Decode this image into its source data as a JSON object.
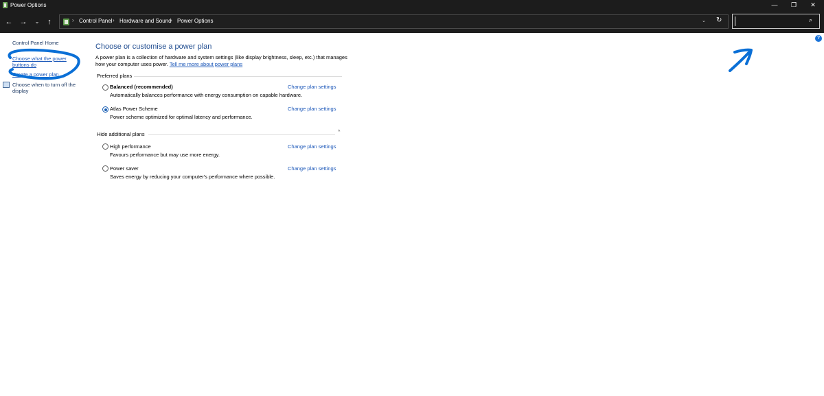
{
  "window": {
    "title": "Power Options",
    "icon": "power-options-icon",
    "controls": {
      "minimize": "—",
      "maximize": "❐",
      "close": "✕"
    }
  },
  "nav": {
    "back": "←",
    "forward": "→",
    "recent": "⌄",
    "up": "↑"
  },
  "address": {
    "separator": "›",
    "crumbs": [
      "Control Panel",
      "Hardware and Sound",
      "Power Options"
    ],
    "dropdown": "⌄",
    "refresh": "↻"
  },
  "search": {
    "value": "",
    "icon": "⌕"
  },
  "help": {
    "label": "?"
  },
  "sidebar": {
    "home": "Control Panel Home",
    "items": [
      {
        "label": "Choose what the power buttons do"
      },
      {
        "label": "Create a power plan"
      },
      {
        "label": "Choose when to turn off the display",
        "icon": "monitor-icon"
      }
    ]
  },
  "main": {
    "title": "Choose or customise a power plan",
    "intro": "A power plan is a collection of hardware and system settings (like display brightness, sleep, etc.) that manages how your computer uses power.",
    "intro_link": "Tell me more about power plans",
    "preferred_heading": "Preferred plans",
    "additional_heading": "Hide additional plans",
    "collapse_glyph": "^",
    "preferred_plans": [
      {
        "name": "Balanced (recommended)",
        "desc": "Automatically balances performance with energy consumption on capable hardware.",
        "link": "Change plan settings",
        "selected": false
      },
      {
        "name": "Atlas Power Scheme",
        "desc": "Power scheme optimized for optimal latency and performance.",
        "link": "Change plan settings",
        "selected": true
      }
    ],
    "additional_plans": [
      {
        "name": "High performance",
        "desc": "Favours performance but may use more energy.",
        "link": "Change plan settings",
        "selected": false
      },
      {
        "name": "Power saver",
        "desc": "Saves energy by reducing your computer's performance where possible.",
        "link": "Change plan settings",
        "selected": false
      }
    ]
  },
  "annotations": {
    "color": "#0a6fd6"
  }
}
